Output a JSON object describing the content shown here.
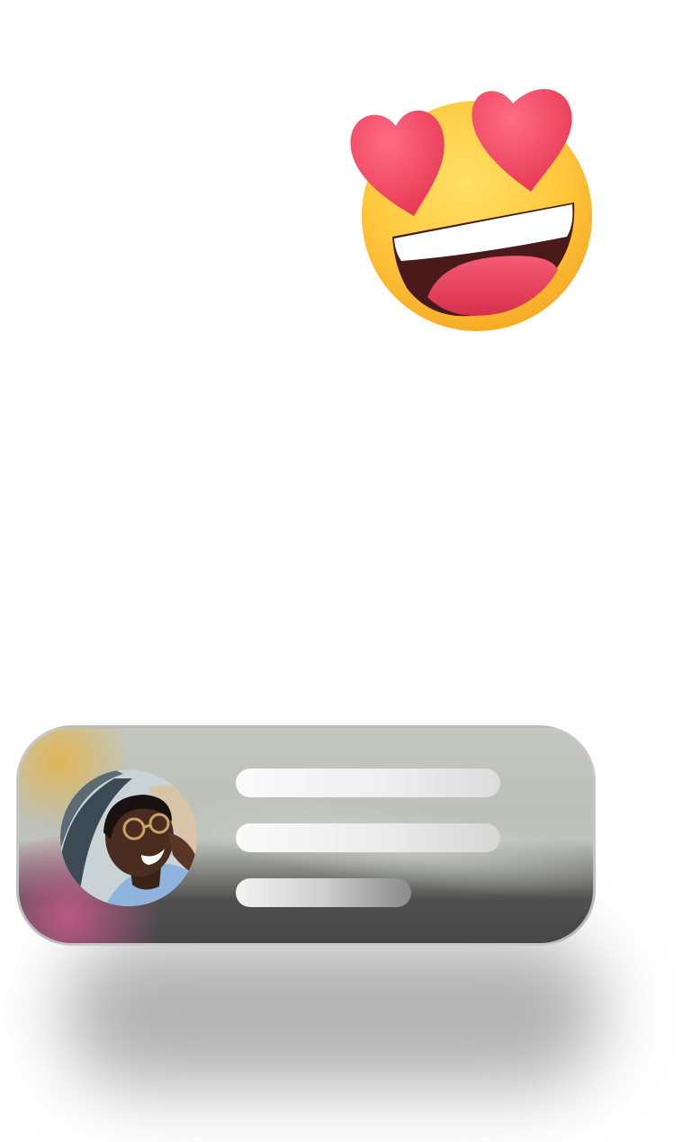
{
  "emoji": {
    "icon": "heart-eyes-emoji-icon",
    "face_color": "#ffc83d",
    "heart_color": "#f2405f",
    "mouth_color": "#e8485f"
  },
  "notification": {
    "avatar_icon": "user-avatar-photo",
    "placeholder_lines": 3,
    "card_colors": {
      "top": "#c2c6be",
      "bottom": "#474747",
      "glow_yellow": "#e6b446",
      "glow_pink": "#c85a8c"
    }
  }
}
